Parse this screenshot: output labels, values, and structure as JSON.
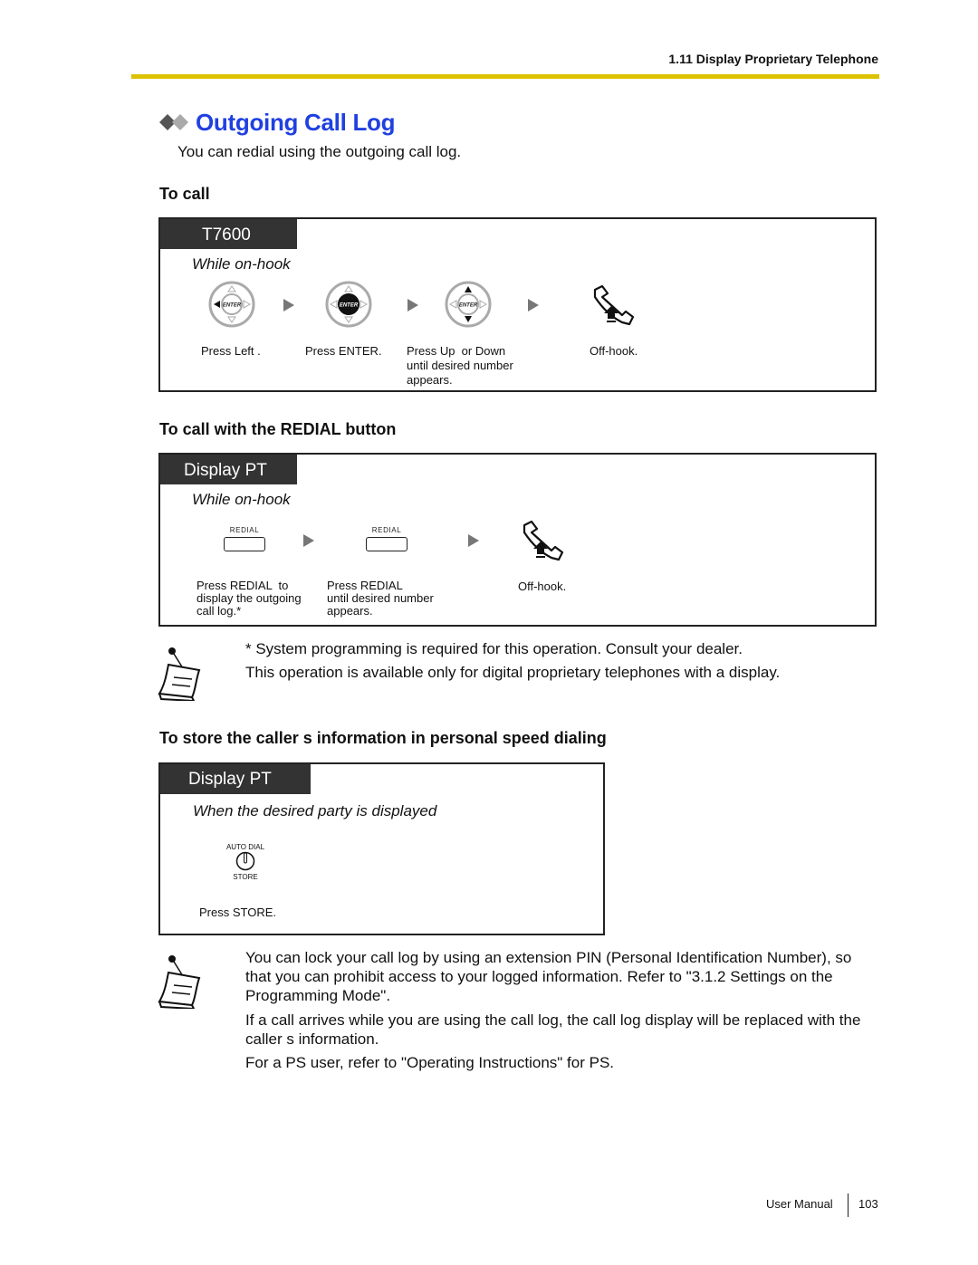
{
  "header": {
    "section": "1.11 Display Proprietary Telephone"
  },
  "title": {
    "text": "Outgoing Call Log",
    "color": "#2040e0",
    "icon": "double-diamond-icon"
  },
  "intro": "You can redial using the outgoing call log.",
  "sections": [
    {
      "heading": "To call",
      "tag": "T7600",
      "condition": "While on-hook",
      "steps": [
        {
          "icon": "navigator-left-icon",
          "caption": "Press Left ."
        },
        {
          "icon": "navigator-enter-icon",
          "caption": "Press ENTER."
        },
        {
          "icon": "navigator-up-down-icon",
          "caption": "Press Up  or Down\nuntil desired number\nappears."
        },
        {
          "icon": "off-hook-icon",
          "caption": "Off-hook."
        }
      ],
      "key_label": "ENTER"
    },
    {
      "heading": "To call with the REDIAL button",
      "tag": "Display PT",
      "condition": "While on-hook",
      "steps": [
        {
          "icon": "redial-key-icon",
          "key_label": "REDIAL",
          "caption": "Press REDIAL  to\ndisplay the outgoing\ncall log.*"
        },
        {
          "icon": "redial-key-icon",
          "key_label": "REDIAL",
          "caption": "Press REDIAL\nuntil desired number\nappears."
        },
        {
          "icon": "off-hook-icon",
          "caption": "Off-hook."
        }
      ]
    },
    {
      "heading": "To store the caller s information in personal speed dialing",
      "tag": "Display PT",
      "condition": "When the desired party is displayed",
      "steps": [
        {
          "icon": "auto-dial-store-key-icon",
          "key_top_label": "AUTO DIAL",
          "key_bottom_label": "STORE",
          "caption": "Press STORE."
        }
      ]
    }
  ],
  "notes": [
    {
      "icon": "notepad-icon",
      "lines": [
        "* System programming is required for this operation. Consult your dealer.",
        "This operation is available only for digital proprietary telephones with a display."
      ]
    },
    {
      "icon": "notepad-icon",
      "paragraphs": [
        "You can lock your call log by using an extension PIN (Personal Identification Number), so that you can prohibit access to your logged information. Refer to \"3.1.2 Settings on the Programming Mode\".",
        "If a call arrives while you are using the call log, the call log display will be replaced with the caller s information.",
        "For a PS user, refer to \"Operating Instructions\" for PS."
      ]
    }
  ],
  "footer": {
    "label": "User Manual",
    "page": "103"
  }
}
